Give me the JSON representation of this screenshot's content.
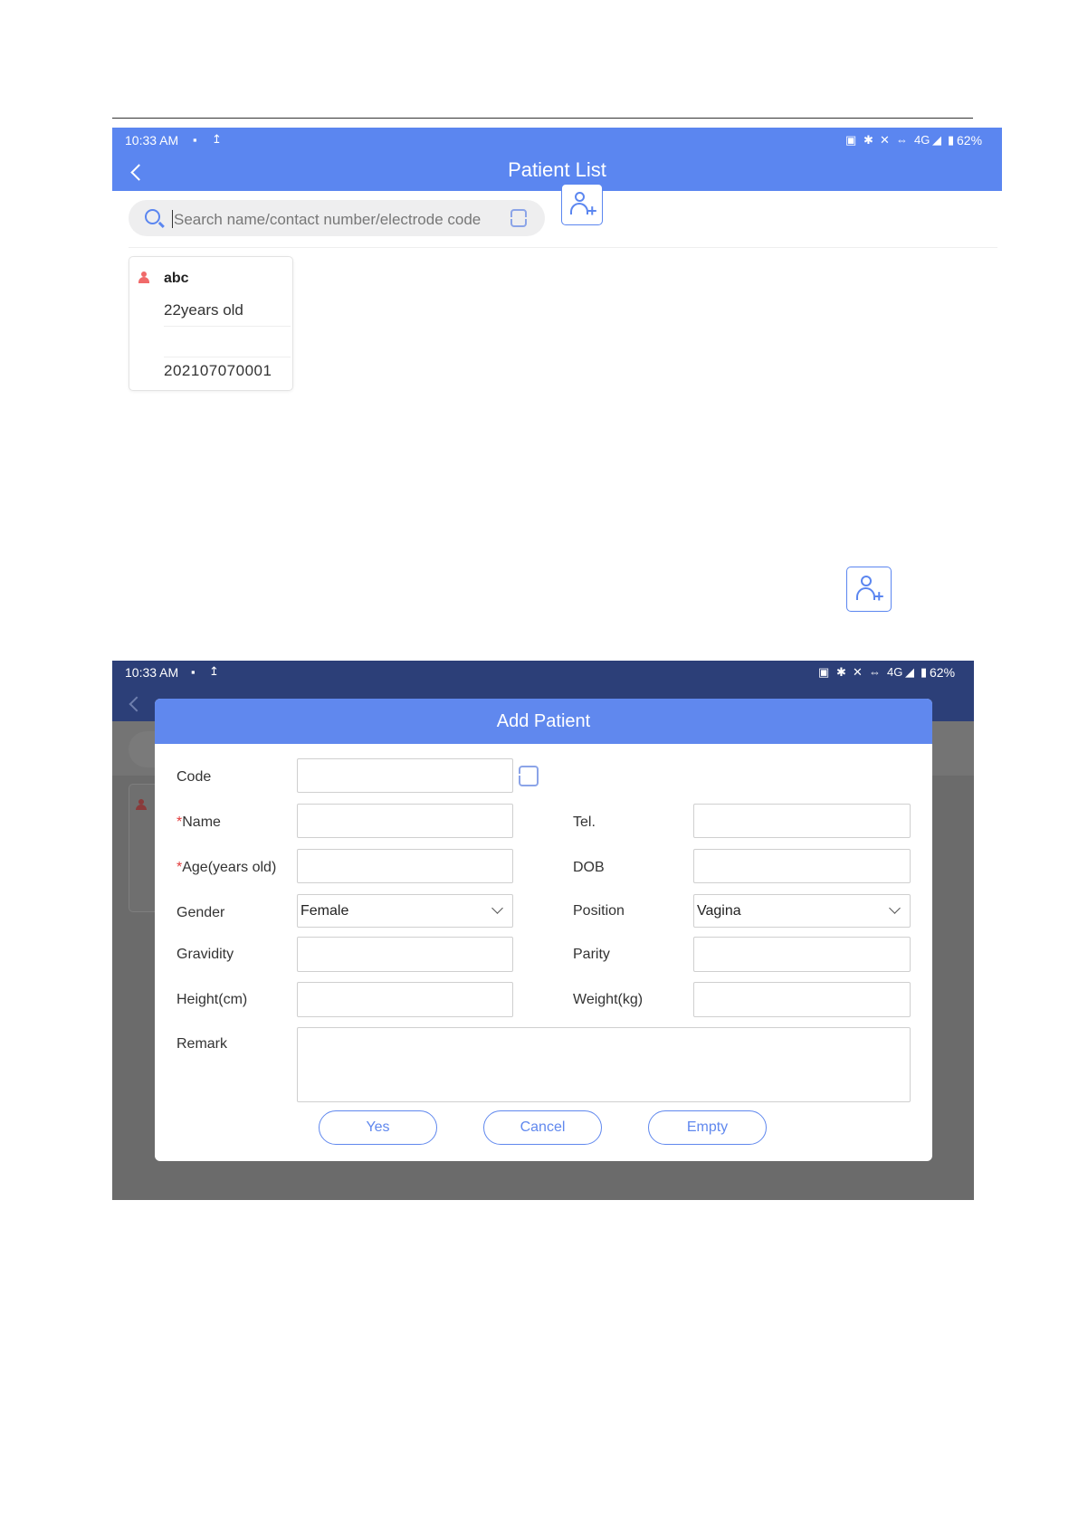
{
  "screen1": {
    "status": {
      "time": "10:33 AM",
      "right": "62%",
      "network": "4G"
    },
    "title": "Patient List",
    "search": {
      "placeholder": "Search name/contact number/electrode code"
    },
    "patient": {
      "name": "abc",
      "age": "22years old",
      "code": "202107070001"
    }
  },
  "screen2": {
    "status": {
      "time": "10:33 AM",
      "right": "62%",
      "network": "4G"
    },
    "dialog_title": "Add Patient",
    "fields": {
      "code": "Code",
      "name_req": "*",
      "name": "Name",
      "tel": "Tel.",
      "age_req": "*",
      "age": "Age(years old)",
      "dob": "DOB",
      "gender": "Gender",
      "gender_value": "Female",
      "position": "Position",
      "position_value": "Vagina",
      "gravidity": "Gravidity",
      "parity": "Parity",
      "height": "Height(cm)",
      "weight": "Weight(kg)",
      "remark": "Remark"
    },
    "buttons": {
      "yes": "Yes",
      "cancel": "Cancel",
      "empty": "Empty"
    }
  },
  "colors": {
    "accent": "#5b86f0",
    "dialog_header": "#6088ee",
    "status_dark": "#2c3f78",
    "required": "#e23b3b"
  }
}
